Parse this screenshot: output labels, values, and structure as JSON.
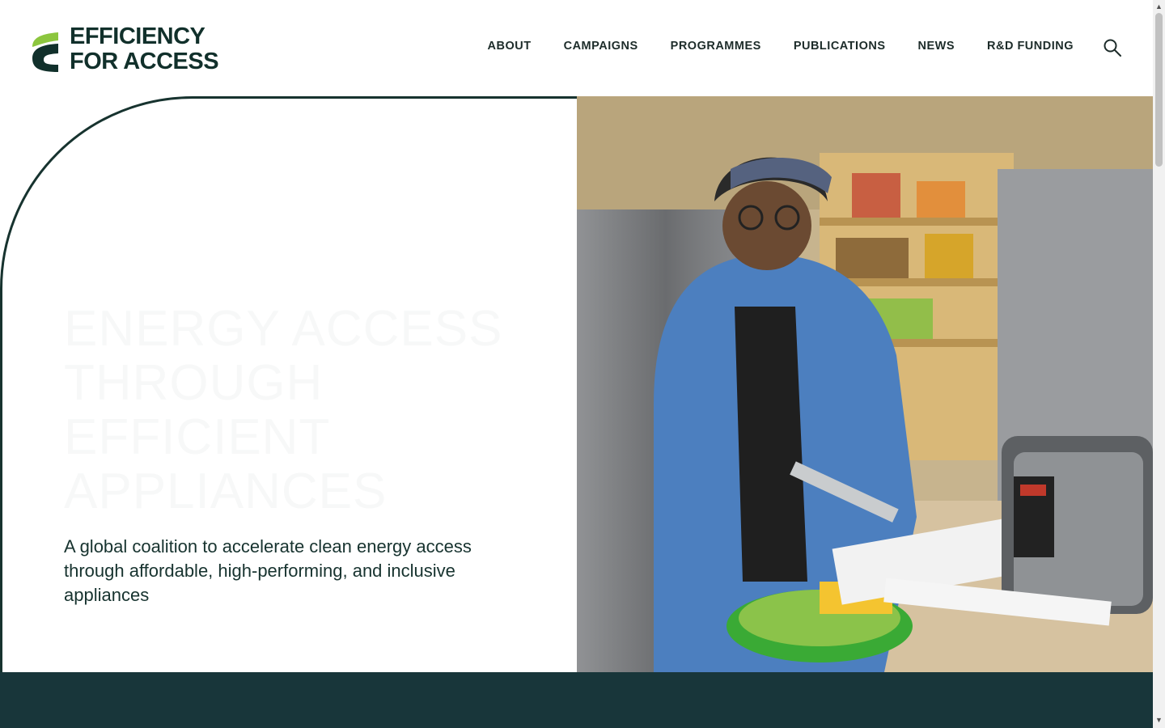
{
  "brand": {
    "line1": "EFFICIENCY",
    "line2": "FOR ACCESS",
    "colors": {
      "dark_green": "#11302b",
      "light_green": "#8cc63e",
      "teal": "#18363a"
    }
  },
  "nav": {
    "items": [
      "ABOUT",
      "CAMPAIGNS",
      "PROGRAMMES",
      "PUBLICATIONS",
      "NEWS",
      "R&D FUNDING"
    ]
  },
  "search": {
    "icon": "search-icon"
  },
  "hero": {
    "title": "ENERGY ACCESS THROUGH EFFICIENT APPLIANCES",
    "subtitle": "A global coalition to accelerate clean energy access through affordable, high-performing, and inclusive appliances"
  }
}
